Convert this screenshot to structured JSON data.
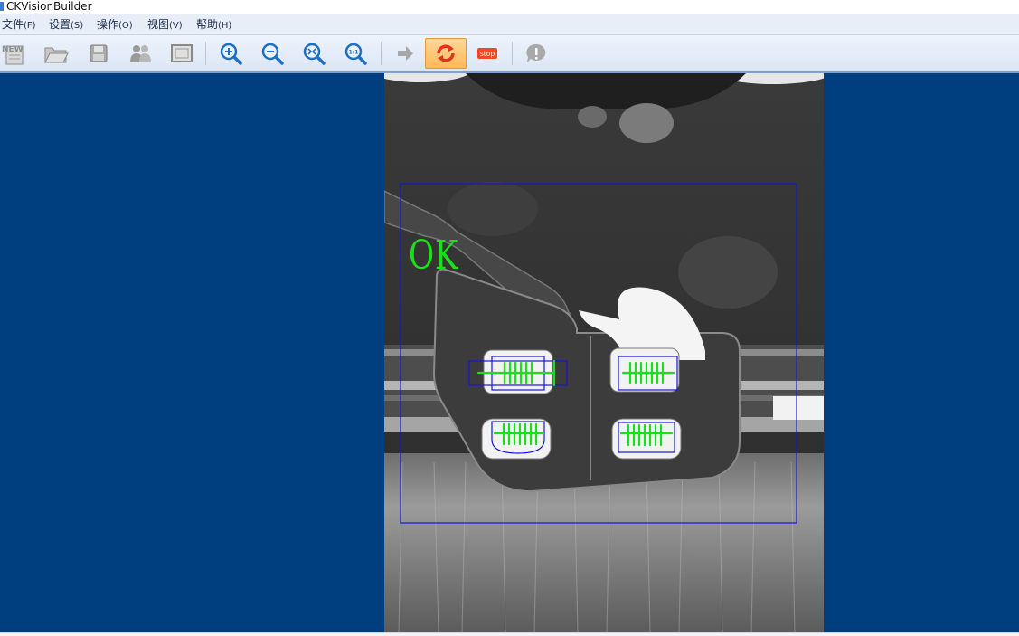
{
  "window": {
    "title": "CKVisionBuilder"
  },
  "menu": [
    {
      "label": "文件",
      "accel": "(F)"
    },
    {
      "label": "设置",
      "accel": "(S)"
    },
    {
      "label": "操作",
      "accel": "(O)"
    },
    {
      "label": "视图",
      "accel": "(V)"
    },
    {
      "label": "帮助",
      "accel": "(H)"
    }
  ],
  "toolbar": {
    "new_label": "NEW",
    "stop_label": "stop",
    "active_button": "run-loop",
    "buttons": [
      "new-icon",
      "open-folder-icon",
      "save-icon",
      "users-icon",
      "fit-window-icon",
      "zoom-in-icon",
      "zoom-out-icon",
      "zoom-fit-icon",
      "zoom-original-icon",
      "run-once-icon",
      "run-loop-icon",
      "stop-icon",
      "about-icon"
    ],
    "zoom_original_label": "1:1"
  },
  "viewer": {
    "result_text": "OK",
    "colors": {
      "background": "#003f7f",
      "roi": "#1616d8",
      "result_ok": "#19e019"
    }
  }
}
